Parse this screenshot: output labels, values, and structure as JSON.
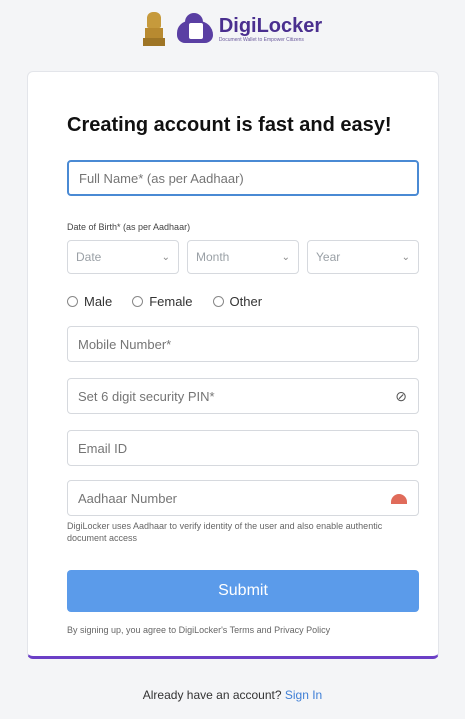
{
  "header": {
    "brand_name": "DigiLocker",
    "brand_tagline": "Document Wallet to Empower Citizens"
  },
  "form": {
    "title": "Creating account is fast and easy!",
    "full_name_placeholder": "Full Name* (as per Aadhaar)",
    "dob_label": "Date of Birth* (as per Aadhaar)",
    "dob_date": "Date",
    "dob_month": "Month",
    "dob_year": "Year",
    "gender_options": [
      "Male",
      "Female",
      "Other"
    ],
    "mobile_placeholder": "Mobile Number*",
    "pin_placeholder": "Set 6 digit security PIN*",
    "email_placeholder": "Email ID",
    "aadhaar_placeholder": "Aadhaar Number",
    "aadhaar_helper": "DigiLocker uses Aadhaar to verify identity of the user and also enable authentic document access",
    "submit_label": "Submit",
    "terms_text": "By signing up, you agree to DigiLocker's Terms and Privacy Policy"
  },
  "footer": {
    "text": "Already have an account?",
    "link": "Sign In"
  },
  "colors": {
    "brand_purple": "#5a3fa3",
    "submit_blue": "#5b9bea",
    "focus_border": "#4a8ad4",
    "link_blue": "#3f7fd6"
  }
}
